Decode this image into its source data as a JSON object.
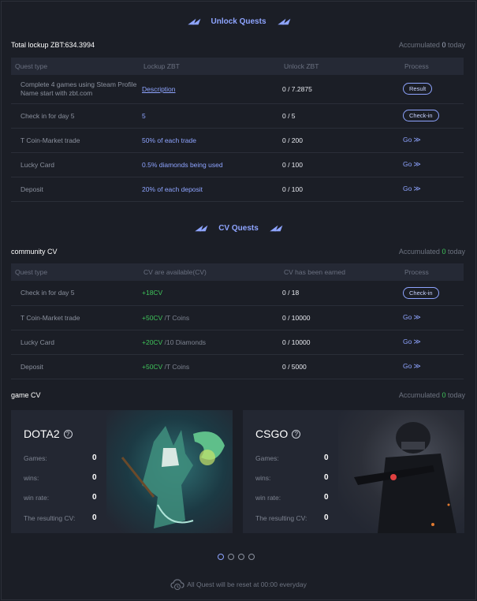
{
  "unlock": {
    "title": "Unlock Quests",
    "total_label": "Total lockup ZBT:634.3994",
    "accum_prefix": "Accumulated",
    "accum_value": "0",
    "accum_suffix": "today",
    "headers": [
      "Quest type",
      "Lockup ZBT",
      "Unlock ZBT",
      "Process"
    ],
    "rows": [
      {
        "type": "Complete 4 games using Steam Profile Name start with zbt.com",
        "lockup": "Description",
        "unlock": "0 / 7.2875",
        "process": "Result"
      },
      {
        "type": "Check in for day 5",
        "lockup": "5",
        "unlock": "0 / 5",
        "process": "Check-in"
      },
      {
        "type": "T Coin-Market trade",
        "lockup": "50% of each trade",
        "unlock": "0 / 200",
        "process": "Go"
      },
      {
        "type": "Lucky Card",
        "lockup": "0.5% diamonds being used",
        "unlock": "0 / 100",
        "process": "Go"
      },
      {
        "type": "Deposit",
        "lockup": "20% of each deposit",
        "unlock": "0 / 100",
        "process": "Go"
      }
    ]
  },
  "cv": {
    "title": "CV Quests",
    "community_label": "community CV",
    "accum_prefix": "Accumulated",
    "accum_value": "0",
    "accum_suffix": "today",
    "headers": [
      "Quest type",
      "CV are available(CV)",
      "CV has been earned",
      "Process"
    ],
    "rows": [
      {
        "type": "Check in for day 5",
        "cv": "+18CV",
        "unit": "",
        "earned": "0 / 18",
        "process": "Check-in"
      },
      {
        "type": "T Coin-Market trade",
        "cv": "+50CV",
        "unit": "/T Coins",
        "earned": "0 / 10000",
        "process": "Go"
      },
      {
        "type": "Lucky Card",
        "cv": "+20CV",
        "unit": "/10 Diamonds",
        "earned": "0 / 10000",
        "process": "Go"
      },
      {
        "type": "Deposit",
        "cv": "+50CV",
        "unit": "/T Coins",
        "earned": "0 / 5000",
        "process": "Go"
      }
    ]
  },
  "game_cv": {
    "label": "game CV",
    "accum_prefix": "Accumulated",
    "accum_value": "0",
    "accum_suffix": "today",
    "cards": [
      {
        "title": "DOTA2",
        "games_label": "Games:",
        "games": "0",
        "wins_label": "wins:",
        "wins": "0",
        "rate_label": "win rate:",
        "rate": "0",
        "cv_label": "The resulting CV:",
        "cv": "0"
      },
      {
        "title": "CSGO",
        "games_label": "Games:",
        "games": "0",
        "wins_label": "wins:",
        "wins": "0",
        "rate_label": "win rate:",
        "rate": "0",
        "cv_label": "The resulting CV:",
        "cv": "0"
      }
    ]
  },
  "footer": {
    "text": "All Quest will be reset at 00:00 everyday"
  },
  "icons": {
    "go": "double-chevron-right-icon",
    "help": "question-circle-icon",
    "reset": "cloud-clock-icon"
  },
  "colors": {
    "accent": "#8ea4ff",
    "green": "#3fc45a",
    "background": "#1b1e26"
  }
}
